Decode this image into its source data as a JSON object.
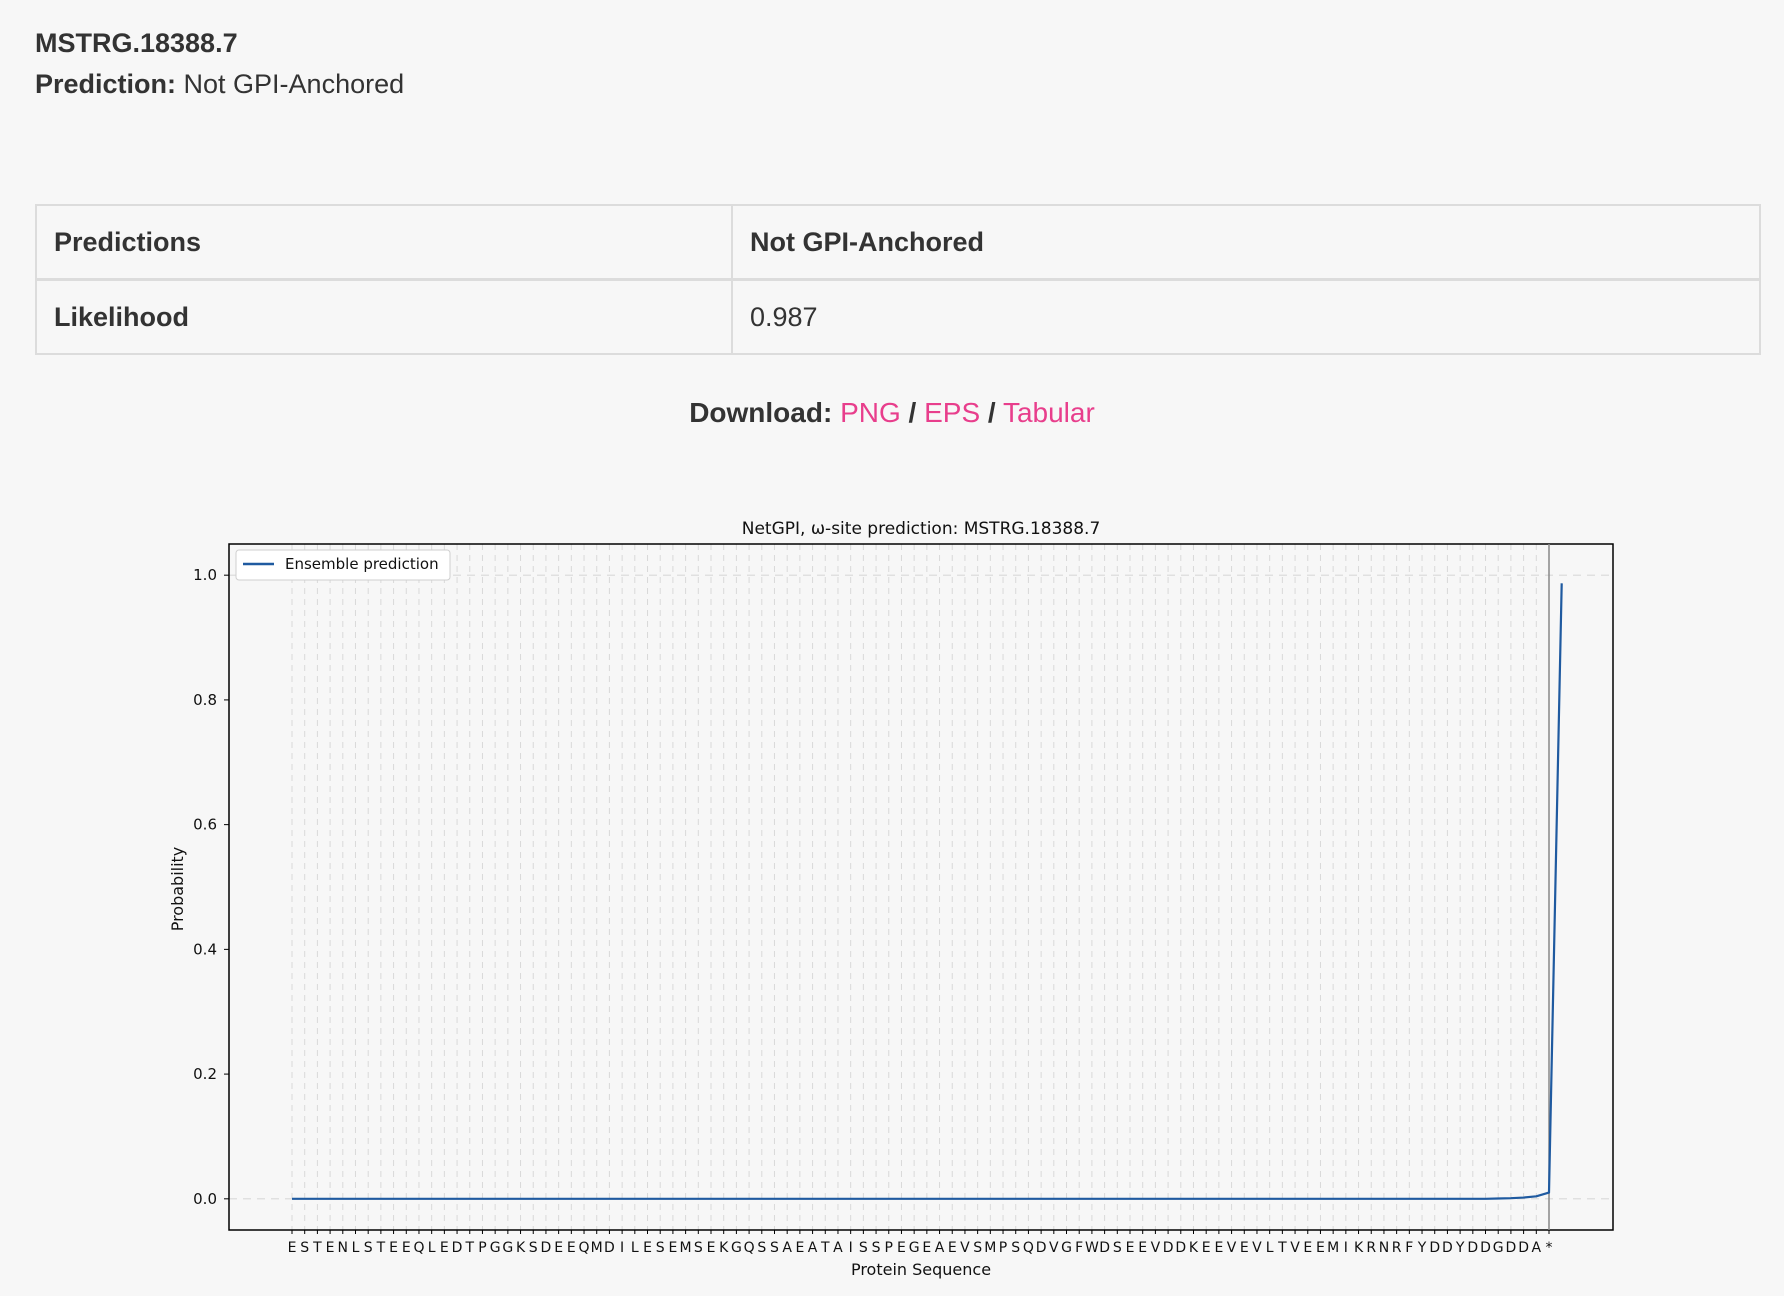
{
  "header": {
    "sequence_id": "MSTRG.18388.7",
    "prediction_label": "Prediction:",
    "prediction_value": "Not GPI-Anchored"
  },
  "results_table": [
    {
      "key": "Predictions",
      "value": "Not GPI-Anchored"
    },
    {
      "key": "Likelihood",
      "value": "0.987"
    }
  ],
  "download": {
    "label": "Download:",
    "separator": "/",
    "links": [
      "PNG",
      "EPS",
      "Tabular"
    ]
  },
  "colors": {
    "link": "#e83e8c",
    "series": "#1f5aa0",
    "omega_site_line": "#f3a0a8"
  },
  "chart_data": {
    "type": "line",
    "title": "NetGPI, ω-site prediction: MSTRG.18388.7",
    "xlabel": "Protein Sequence",
    "ylabel": "Probability",
    "ylim": [
      -0.05,
      1.05
    ],
    "yticks": [
      0.0,
      0.2,
      0.4,
      0.6,
      0.8,
      1.0
    ],
    "ytick_labels": [
      "0.0",
      "0.2",
      "0.4",
      "0.6",
      "0.8",
      "1.0"
    ],
    "grid": true,
    "legend_position": "top-left",
    "categories": [
      "E",
      "S",
      "T",
      "E",
      "N",
      "L",
      "S",
      "T",
      "E",
      "E",
      "Q",
      "L",
      "E",
      "D",
      "T",
      "P",
      "G",
      "G",
      "K",
      "S",
      "D",
      "E",
      "E",
      "Q",
      "M",
      "D",
      "I",
      "L",
      "E",
      "S",
      "E",
      "M",
      "S",
      "E",
      "K",
      "G",
      "Q",
      "S",
      "S",
      "A",
      "E",
      "A",
      "T",
      "A",
      "I",
      "S",
      "S",
      "P",
      "E",
      "G",
      "E",
      "A",
      "E",
      "V",
      "S",
      "M",
      "P",
      "S",
      "Q",
      "D",
      "V",
      "G",
      "F",
      "W",
      "D",
      "S",
      "E",
      "E",
      "V",
      "D",
      "D",
      "K",
      "E",
      "E",
      "V",
      "E",
      "V",
      "L",
      "T",
      "V",
      "E",
      "E",
      "M",
      "I",
      "K",
      "R",
      "N",
      "R",
      "F",
      "Y",
      "D",
      "D",
      "Y",
      "D",
      "D",
      "G",
      "D",
      "D",
      "A",
      "*"
    ],
    "series": [
      {
        "name": "Ensemble prediction",
        "values": [
          0,
          0,
          0,
          0,
          0,
          0,
          0,
          0,
          0,
          0,
          0,
          0,
          0,
          0,
          0,
          0,
          0,
          0,
          0,
          0,
          0,
          0,
          0,
          0,
          0,
          0,
          0,
          0,
          0,
          0,
          0,
          0,
          0,
          0,
          0,
          0,
          0,
          0,
          0,
          0,
          0,
          0,
          0,
          0,
          0,
          0,
          0,
          0,
          0,
          0,
          0,
          0,
          0,
          0,
          0,
          0,
          0,
          0,
          0,
          0,
          0,
          0,
          0,
          0,
          0,
          0,
          0,
          0,
          0,
          0,
          0,
          0,
          0,
          0,
          0,
          0,
          0,
          0,
          0,
          0,
          0,
          0,
          0,
          0,
          0,
          0,
          0,
          0,
          0,
          0,
          0,
          0,
          0,
          0,
          0,
          0.0005,
          0.001,
          0.002,
          0.004,
          0.01,
          0.987
        ]
      }
    ],
    "vertical_marker_category_index": 99
  }
}
